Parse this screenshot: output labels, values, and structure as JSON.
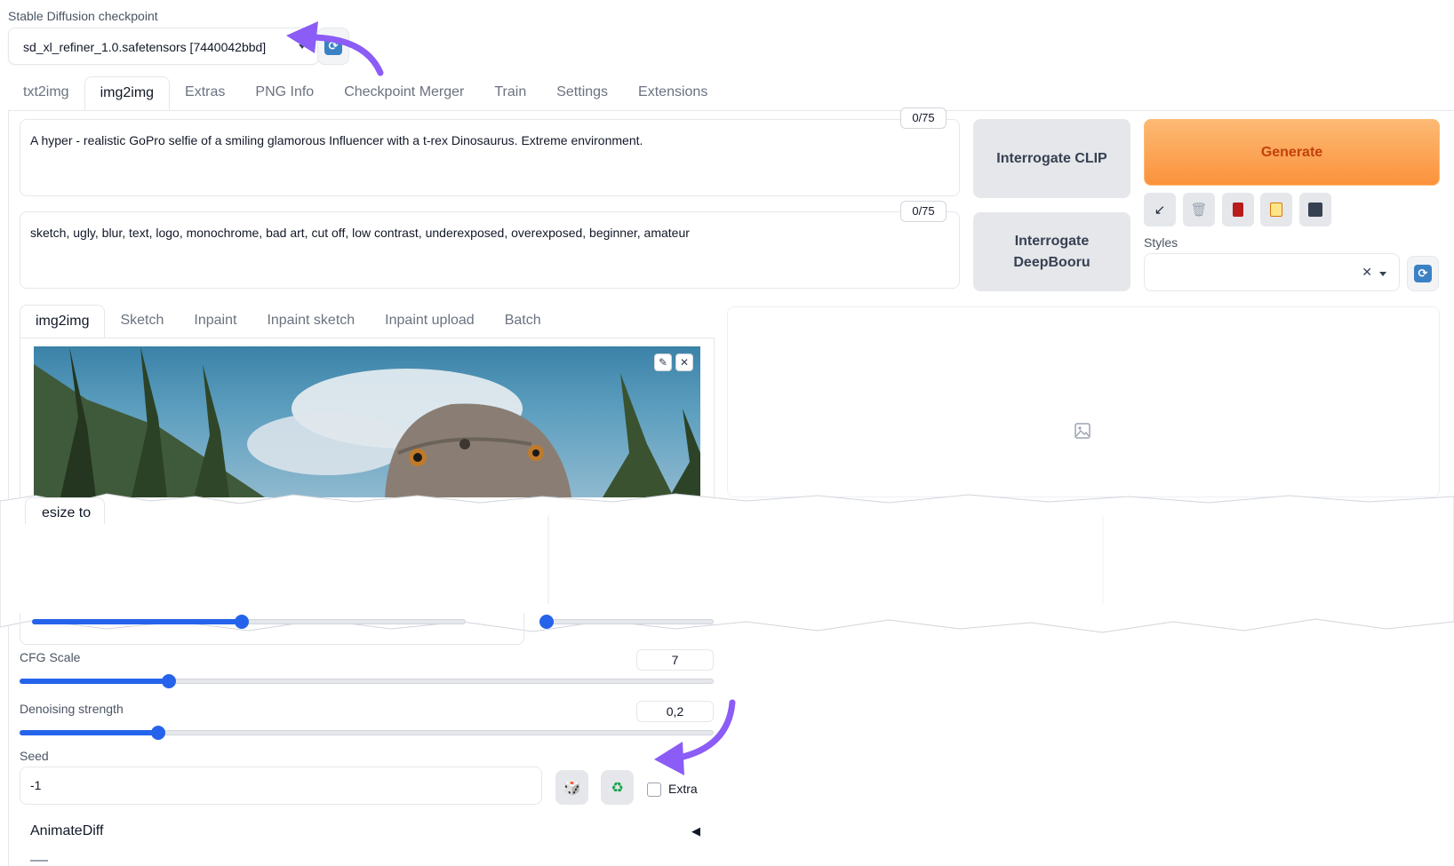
{
  "checkpoint": {
    "label": "Stable Diffusion checkpoint",
    "value": "sd_xl_refiner_1.0.safetensors [7440042bbd]",
    "refresh_icon": "refresh-icon"
  },
  "main_tabs": [
    {
      "label": "txt2img",
      "active": false
    },
    {
      "label": "img2img",
      "active": true
    },
    {
      "label": "Extras",
      "active": false
    },
    {
      "label": "PNG Info",
      "active": false
    },
    {
      "label": "Checkpoint Merger",
      "active": false
    },
    {
      "label": "Train",
      "active": false
    },
    {
      "label": "Settings",
      "active": false
    },
    {
      "label": "Extensions",
      "active": false
    }
  ],
  "prompt": {
    "positive": "A hyper - realistic GoPro selfie of a smiling glamorous Influencer with a t-rex Dinosaurus. Extreme environment.",
    "positive_counter": "0/75",
    "negative": "sketch, ugly, blur, text, logo, monochrome, bad art, cut off, low contrast, underexposed, overexposed, beginner, amateur",
    "negative_counter": "0/75"
  },
  "buttons": {
    "interrogate_clip": "Interrogate CLIP",
    "interrogate_deepbooru": "Interrogate DeepBooru",
    "generate": "Generate"
  },
  "tools": [
    "arrow-icon",
    "trash-icon",
    "card-icon",
    "clipboard-icon",
    "save-icon"
  ],
  "styles": {
    "label": "Styles",
    "clear": "✕"
  },
  "sub_tabs": [
    {
      "label": "img2img",
      "active": true
    },
    {
      "label": "Sketch",
      "active": false
    },
    {
      "label": "Inpaint",
      "active": false
    },
    {
      "label": "Inpaint sketch",
      "active": false
    },
    {
      "label": "Inpaint upload",
      "active": false
    },
    {
      "label": "Batch",
      "active": false
    }
  ],
  "resize_tab_partial": "esize to",
  "cfg_scale": {
    "label": "CFG Scale",
    "value": "7",
    "min": 1,
    "max": 30,
    "level": 0.215
  },
  "denoising": {
    "label": "Denoising strength",
    "value": "0,2",
    "min": 0,
    "max": 1,
    "level": 0.2
  },
  "seed": {
    "label": "Seed",
    "value": "-1",
    "extra_label": "Extra"
  },
  "animatediff": {
    "label": "AnimateDiff",
    "arrow": "◀"
  },
  "colors": {
    "accent": "#2563eb",
    "generate": "#fb923c",
    "generate_text": "#c2410c",
    "annotation": "#8b5cf6"
  }
}
